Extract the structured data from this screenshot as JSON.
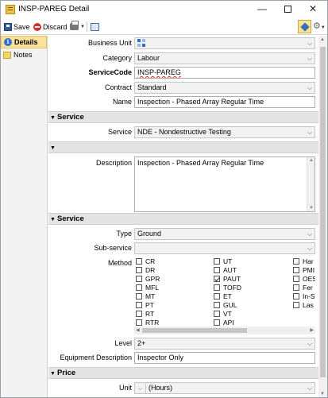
{
  "window": {
    "title": "INSP-PAREG  Detail"
  },
  "toolbar": {
    "save_label": "Save",
    "discard_label": "Discard"
  },
  "sidebar": {
    "items": [
      {
        "label": "Details",
        "active": true
      },
      {
        "label": "Notes",
        "active": false
      }
    ]
  },
  "fields": {
    "business_unit": {
      "label": "Business Unit",
      "value": ""
    },
    "category": {
      "label": "Category",
      "value": "Labour"
    },
    "service_code": {
      "label": "ServiceCode",
      "value": "INSP-PAREG"
    },
    "contract": {
      "label": "Contract",
      "value": "Standard"
    },
    "name": {
      "label": "Name",
      "value": "Inspection - Phased Array Regular Time"
    }
  },
  "section_service_1": {
    "title": "Service",
    "service_label": "Service",
    "service_value": "NDE - Nondestructive Testing"
  },
  "section_blank": {
    "title": ""
  },
  "description": {
    "label": "Description",
    "value": "Inspection - Phased Array Regular Time"
  },
  "section_service_2": {
    "title": "Service",
    "type_label": "Type",
    "type_value": "Ground",
    "subservice_label": "Sub-service",
    "subservice_value": "",
    "method_label": "Method",
    "methods_col1": [
      {
        "code": "CR",
        "checked": false
      },
      {
        "code": "DR",
        "checked": false
      },
      {
        "code": "GPR",
        "checked": false
      },
      {
        "code": "MFL",
        "checked": false
      },
      {
        "code": "MT",
        "checked": false
      },
      {
        "code": "PT",
        "checked": false
      },
      {
        "code": "RT",
        "checked": false
      },
      {
        "code": "RTR",
        "checked": false
      }
    ],
    "methods_col2": [
      {
        "code": "UT",
        "checked": false
      },
      {
        "code": "AUT",
        "checked": false
      },
      {
        "code": "PAUT",
        "checked": true
      },
      {
        "code": "TOFD",
        "checked": false
      },
      {
        "code": "ET",
        "checked": false
      },
      {
        "code": "GUL",
        "checked": false
      },
      {
        "code": "VT",
        "checked": false
      },
      {
        "code": "API",
        "checked": false
      }
    ],
    "methods_col3": [
      {
        "code": "Har",
        "checked": false
      },
      {
        "code": "PMI",
        "checked": false
      },
      {
        "code": "OES",
        "checked": false
      },
      {
        "code": "Fer",
        "checked": false
      },
      {
        "code": "In-S",
        "checked": false
      },
      {
        "code": "Las",
        "checked": false
      }
    ],
    "level_label": "Level",
    "level_value": "2+",
    "equip_label": "Equipment Description",
    "equip_value": "Inspector Only"
  },
  "section_price": {
    "title": "Price",
    "unit_label": "Unit",
    "unit_value": "(Hours)"
  },
  "colors": {
    "accent": "#fbe29a",
    "section_bg": "#e4e4e4",
    "link_blue": "#2f6fd0"
  }
}
